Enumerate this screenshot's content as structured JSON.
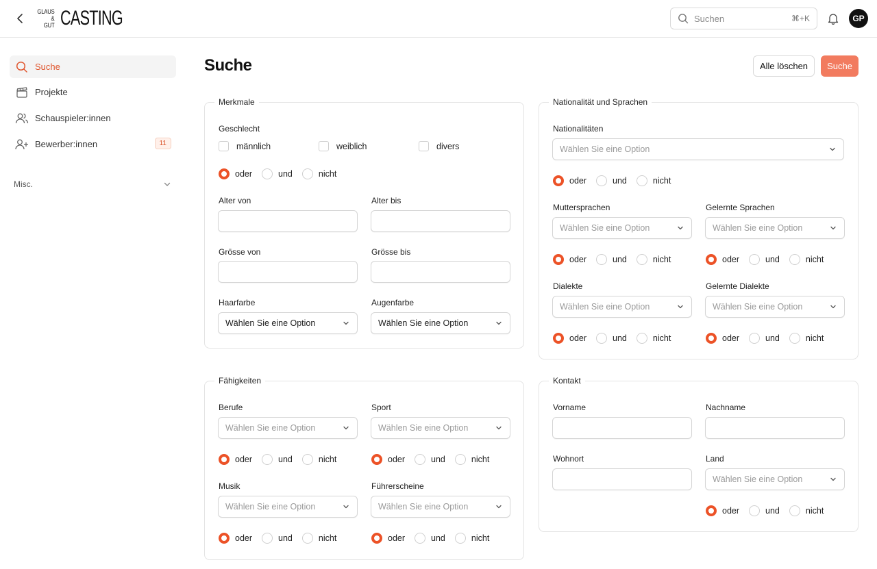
{
  "header": {
    "logo_small_top": "GLAUS &",
    "logo_small_bottom": "GUT",
    "logo_big": "CASTING",
    "search_placeholder": "Suchen",
    "search_shortcut": "⌘+K",
    "avatar_initials": "GP"
  },
  "sidebar": {
    "items": [
      {
        "label": "Suche",
        "icon": "search-icon",
        "active": true
      },
      {
        "label": "Projekte",
        "icon": "clapperboard-icon"
      },
      {
        "label": "Schauspieler:innen",
        "icon": "users-icon"
      },
      {
        "label": "Bewerber:innen",
        "icon": "user-plus-icon",
        "badge": "11"
      }
    ],
    "misc_label": "Misc."
  },
  "main": {
    "title": "Suche",
    "clear_button": "Alle löschen",
    "search_button": "Suche"
  },
  "common": {
    "select_placeholder": "Wählen Sie eine Option",
    "radio": {
      "or": "oder",
      "and": "und",
      "not": "nicht"
    }
  },
  "merkmale": {
    "legend": "Merkmale",
    "gender_label": "Geschlecht",
    "gender_options": [
      "männlich",
      "weiblich",
      "divers"
    ],
    "age_from": "Alter von",
    "age_to": "Alter bis",
    "height_from": "Grösse von",
    "height_to": "Grösse bis",
    "hair": "Haarfarbe",
    "eyes": "Augenfarbe"
  },
  "nationalitaet": {
    "legend": "Nationalität und Sprachen",
    "nationalities": "Nationalitäten",
    "mother_tongues": "Muttersprachen",
    "learned_languages": "Gelernte Sprachen",
    "dialects": "Dialekte",
    "learned_dialects": "Gelernte Dialekte"
  },
  "faehigkeiten": {
    "legend": "Fähigkeiten",
    "professions": "Berufe",
    "sport": "Sport",
    "music": "Musik",
    "licenses": "Führerscheine"
  },
  "kontakt": {
    "legend": "Kontakt",
    "first_name": "Vorname",
    "last_name": "Nachname",
    "residence": "Wohnort",
    "country": "Land"
  },
  "colors": {
    "accent": "#ec5227",
    "primary_button": "#f27b5f",
    "active_nav_bg": "#f4f4f4"
  }
}
